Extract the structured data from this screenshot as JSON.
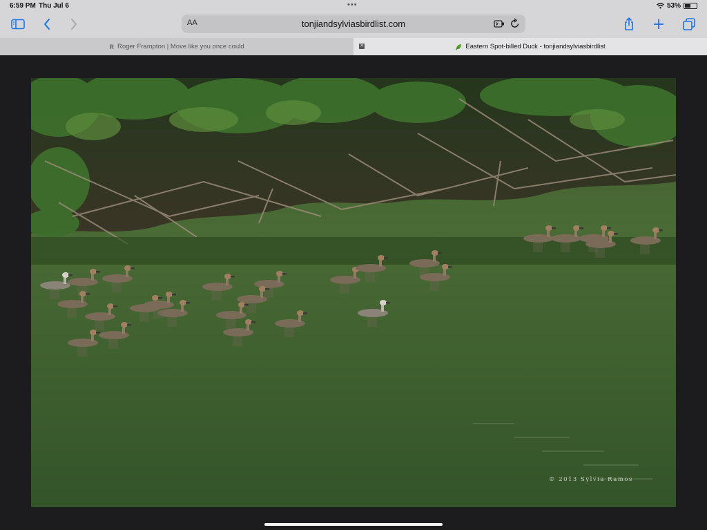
{
  "status_bar": {
    "time": "6:59 PM",
    "date": "Thu Jul 6",
    "battery_percent": "53%",
    "battery_level": 0.53,
    "wifi_icon": "wifi-icon"
  },
  "toolbar": {
    "sidebar_icon": "sidebar-icon",
    "back_icon": "chevron-left-icon",
    "forward_icon": "chevron-right-icon",
    "reader_label": "AA",
    "url": "tonjiandsylviasbirdlist.com",
    "extension_icon": "extension-icon",
    "reload_icon": "reload-icon",
    "share_icon": "share-icon",
    "new_tab_icon": "plus-icon",
    "tabs_icon": "tabs-overview-icon",
    "accent": "#1a73e8"
  },
  "tabs": [
    {
      "title": "Roger Frampton | Move like you once could",
      "active": false,
      "favicon": "R"
    },
    {
      "title": "Eastern Spot-billed Duck - tonjiandsylviasbirdlist",
      "active": true,
      "favicon": "leaf"
    }
  ],
  "photo": {
    "watermark": "© 2013 Sylvia Ramos"
  }
}
